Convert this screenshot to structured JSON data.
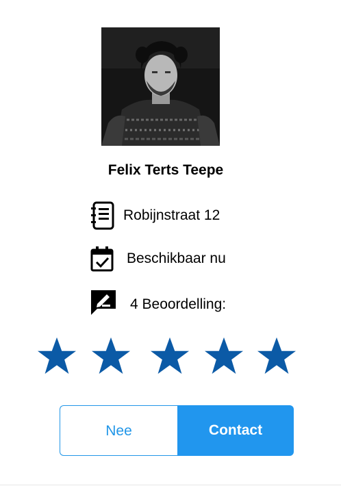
{
  "profile": {
    "name": "Felix Terts Teepe"
  },
  "info": {
    "address": "Robijnstraat 12",
    "address_icon": "address-book-icon",
    "availability": "Beschikbaar nu",
    "availability_icon": "calendar-check-icon",
    "rating_label": "4 Beoordelling:",
    "rating_icon": "review-pen-icon"
  },
  "rating": {
    "stars_shown": 5,
    "star_color": "#0b5aa6"
  },
  "actions": {
    "nee_label": "Nee",
    "contact_label": "Contact"
  },
  "colors": {
    "accent": "#2196ee"
  }
}
